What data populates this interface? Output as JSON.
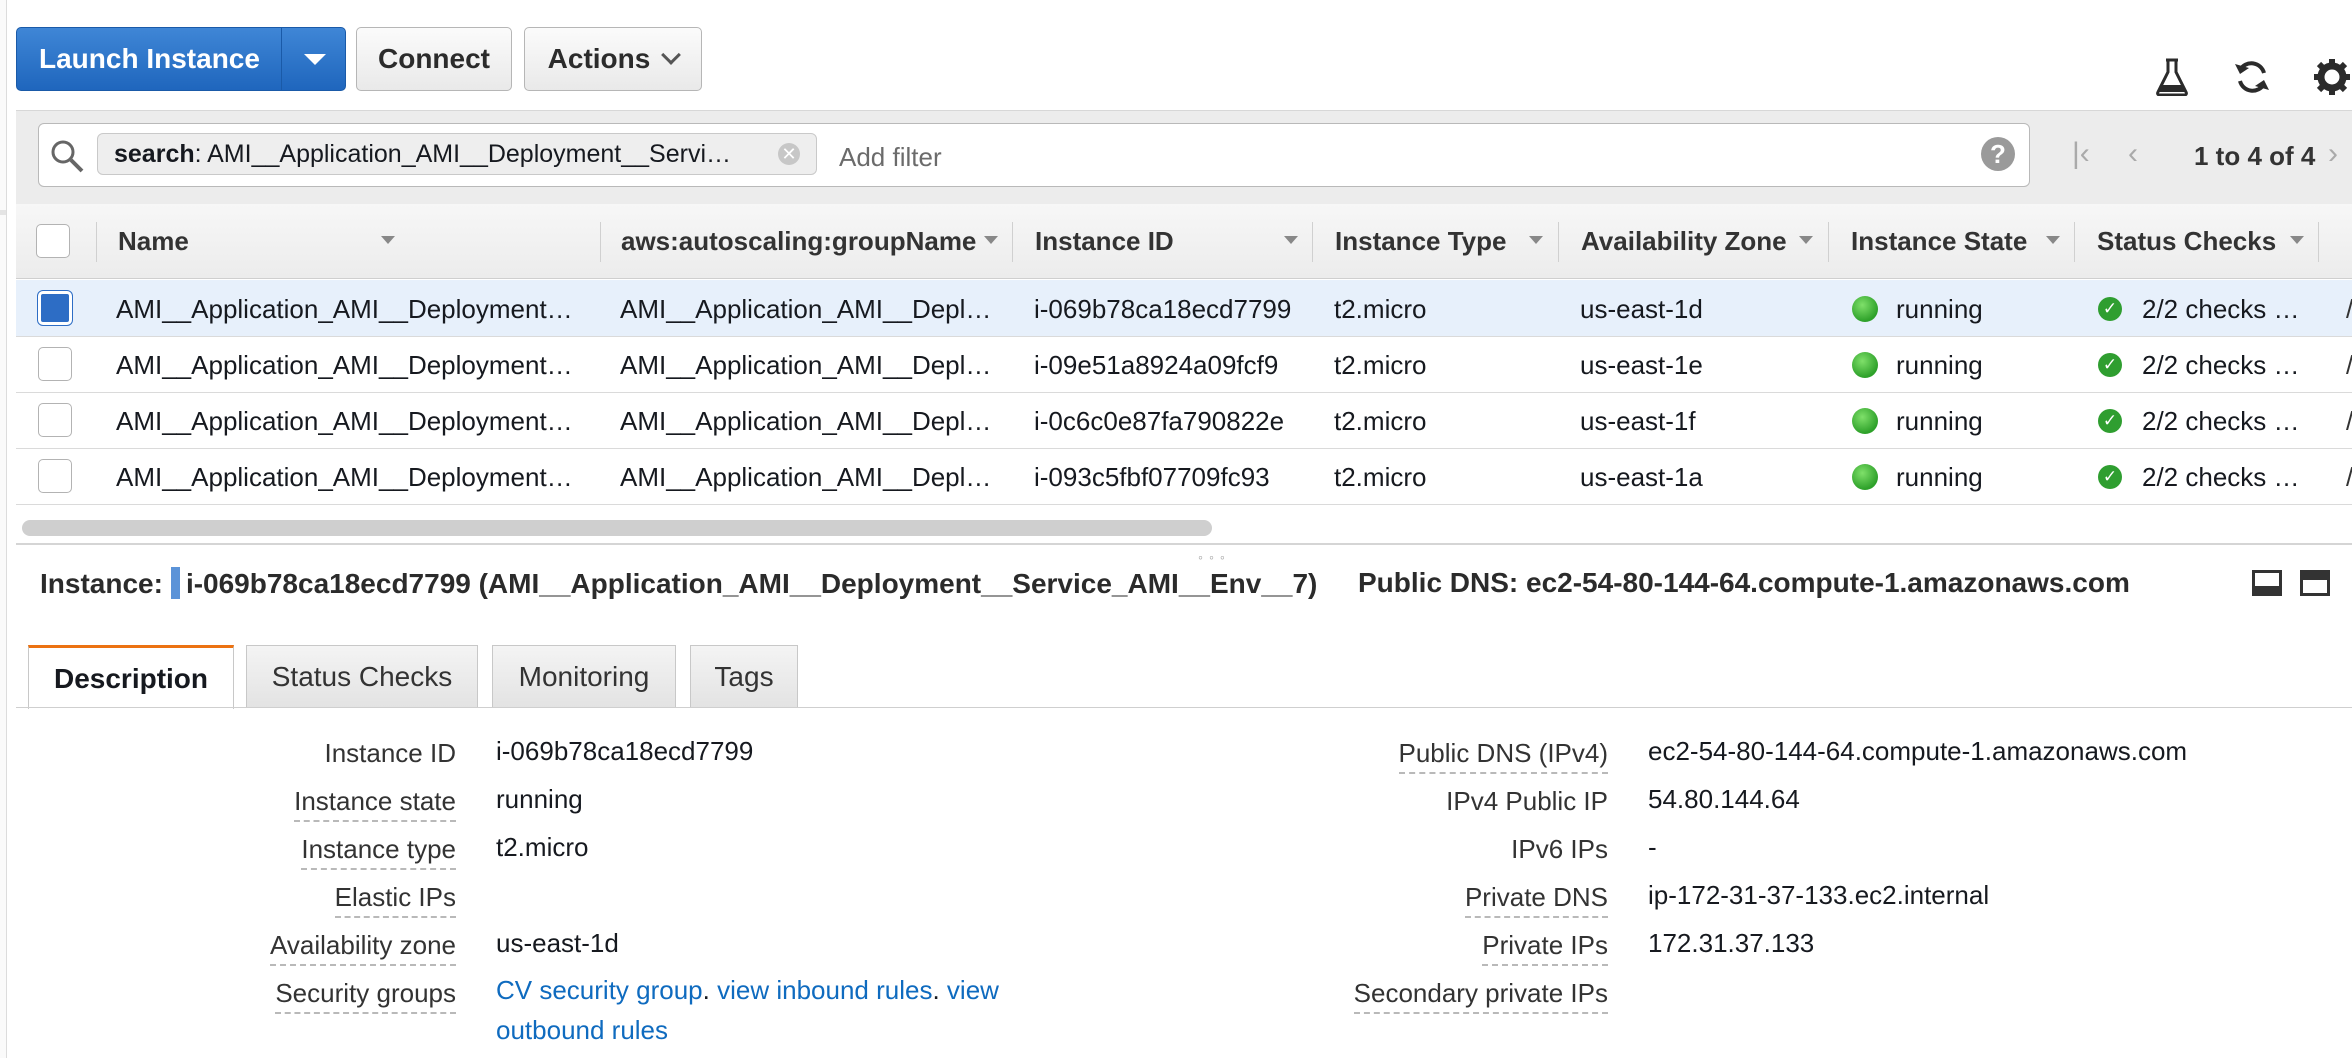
{
  "toolbar": {
    "launch_label": "Launch Instance",
    "connect_label": "Connect",
    "actions_label": "Actions"
  },
  "icons": {
    "experiment": "flask-icon",
    "refresh": "refresh-icon",
    "settings": "gear-icon"
  },
  "filter": {
    "chip_key": "search",
    "chip_value": " : AMI__Application_AMI__Deployment__Servi…",
    "placeholder": "Add filter",
    "help": "?"
  },
  "pager": {
    "text": "1 to 4 of 4"
  },
  "table": {
    "columns": [
      "Name",
      "aws:autoscaling:groupName",
      "Instance ID",
      "Instance Type",
      "Availability Zone",
      "Instance State",
      "Status Checks"
    ],
    "rows": [
      {
        "name": "AMI__Application_AMI__Deployment…",
        "group": "AMI__Application_AMI__Depl…",
        "id": "i-069b78ca18ecd7799",
        "type": "t2.micro",
        "az": "us-east-1d",
        "state": "running",
        "checks": "2/2 checks …",
        "selected": true
      },
      {
        "name": "AMI__Application_AMI__Deployment…",
        "group": "AMI__Application_AMI__Depl…",
        "id": "i-09e51a8924a09fcf9",
        "type": "t2.micro",
        "az": "us-east-1e",
        "state": "running",
        "checks": "2/2 checks …",
        "selected": false
      },
      {
        "name": "AMI__Application_AMI__Deployment…",
        "group": "AMI__Application_AMI__Depl…",
        "id": "i-0c6c0e87fa790822e",
        "type": "t2.micro",
        "az": "us-east-1f",
        "state": "running",
        "checks": "2/2 checks …",
        "selected": false
      },
      {
        "name": "AMI__Application_AMI__Deployment…",
        "group": "AMI__Application_AMI__Depl…",
        "id": "i-093c5fbf07709fc93",
        "type": "t2.micro",
        "az": "us-east-1a",
        "state": "running",
        "checks": "2/2 checks …",
        "selected": false
      }
    ]
  },
  "details": {
    "instance_label": "Instance:",
    "instance_value": "i-069b78ca18ecd7799 (AMI__Application_AMI__Deployment__Service_AMI__Env__7)",
    "dns_label": "Public DNS:",
    "dns_value": "ec2-54-80-144-64.compute-1.amazonaws.com",
    "tabs": [
      "Description",
      "Status Checks",
      "Monitoring",
      "Tags"
    ],
    "left_fields": [
      {
        "label": "Instance ID",
        "value": "i-069b78ca18ecd7799"
      },
      {
        "label": "Instance state",
        "value": "running"
      },
      {
        "label": "Instance type",
        "value": "t2.micro"
      },
      {
        "label": "Elastic IPs",
        "value": ""
      },
      {
        "label": "Availability zone",
        "value": "us-east-1d"
      },
      {
        "label": "Security groups",
        "value": ""
      }
    ],
    "security_links": {
      "group": "CV security group",
      "sep1": ". ",
      "inbound": "view inbound rules",
      "sep2": ". ",
      "outbound_a": "view",
      "outbound_b": "outbound rules"
    },
    "right_fields": [
      {
        "label": "Public DNS (IPv4)",
        "value": "ec2-54-80-144-64.compute-1.amazonaws.com"
      },
      {
        "label": "IPv4 Public IP",
        "value": "54.80.144.64"
      },
      {
        "label": "IPv6 IPs",
        "value": "-"
      },
      {
        "label": "Private DNS",
        "value": "ip-172-31-37-133.ec2.internal"
      },
      {
        "label": "Private IPs",
        "value": "172.31.37.133"
      },
      {
        "label": "Secondary private IPs",
        "value": ""
      }
    ]
  },
  "colors": {
    "primary": "#1f66bd",
    "accent_tab": "#ec7211",
    "selected_row": "#e7f0fb",
    "status_ok": "#2f9e30",
    "link": "#0f6bbf"
  }
}
